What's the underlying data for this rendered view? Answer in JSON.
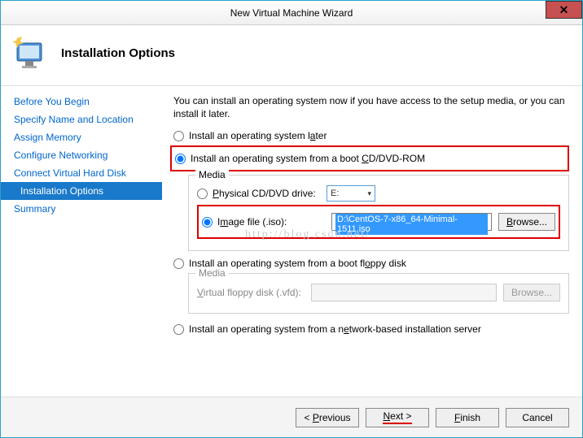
{
  "titlebar": {
    "title": "New Virtual Machine Wizard"
  },
  "header": {
    "title": "Installation Options"
  },
  "sidebar": {
    "items": [
      {
        "label": "Before You Begin"
      },
      {
        "label": "Specify Name and Location"
      },
      {
        "label": "Assign Memory"
      },
      {
        "label": "Configure Networking"
      },
      {
        "label": "Connect Virtual Hard Disk"
      },
      {
        "label": "Installation Options"
      },
      {
        "label": "Summary"
      }
    ]
  },
  "main": {
    "intro": "You can install an operating system now if you have access to the setup media, or you can install it later.",
    "opt_later": "Install an operating system later",
    "opt_cd": "Install an operating system from a boot CD/DVD-ROM",
    "media_legend": "Media",
    "physical_label": "Physical CD/DVD drive:",
    "physical_drive": "E:",
    "image_label": "Image file (.iso):",
    "image_path": "D:\\CentOS-7-x86_64-Minimal-1511.iso",
    "browse": "Browse...",
    "opt_floppy": "Install an operating system from a boot floppy disk",
    "floppy_legend": "Media",
    "vfd_label": "Virtual floppy disk (.vfd):",
    "browse2": "Browse...",
    "opt_network": "Install an operating system from a network-based installation server"
  },
  "footer": {
    "previous": "< Previous",
    "next": "Next >",
    "finish": "Finish",
    "cancel": "Cancel"
  },
  "watermark": "http://blog.csdn.net/"
}
